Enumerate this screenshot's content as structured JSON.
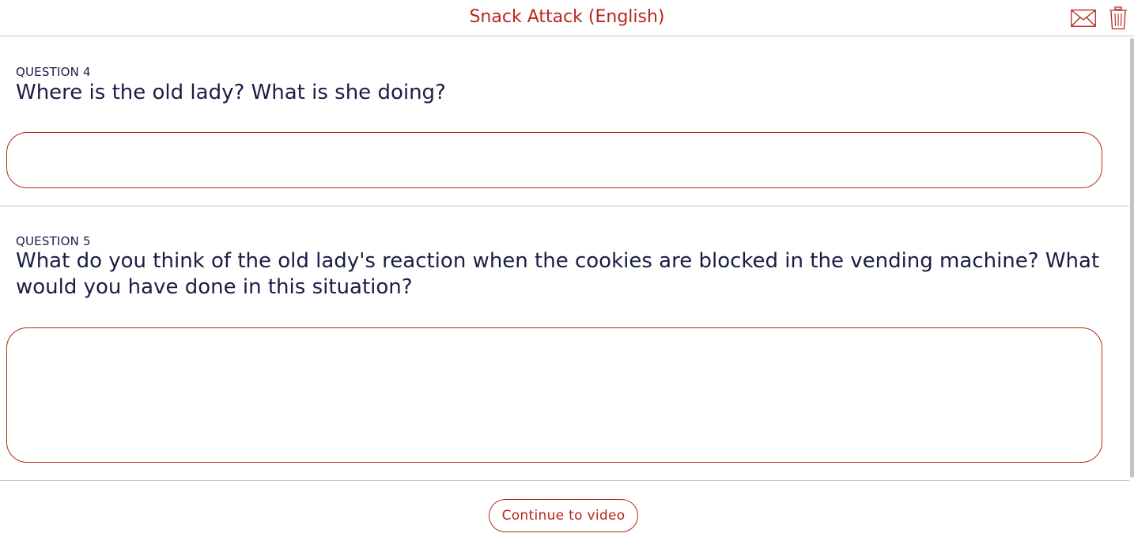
{
  "header": {
    "title": "Snack Attack (English)",
    "icons": [
      "mail-icon",
      "trash-icon"
    ],
    "accent_color": "#b8261c"
  },
  "questions": [
    {
      "label": "QUESTION 4",
      "text": "Where is the old lady? What is she doing?",
      "answer": ""
    },
    {
      "label": "QUESTION 5",
      "text": "What do you think of the old lady's reaction when the cookies are blocked in the vending machine? What would you have done in this situation?",
      "answer": ""
    }
  ],
  "footer": {
    "continue_label": "Continue to video"
  }
}
